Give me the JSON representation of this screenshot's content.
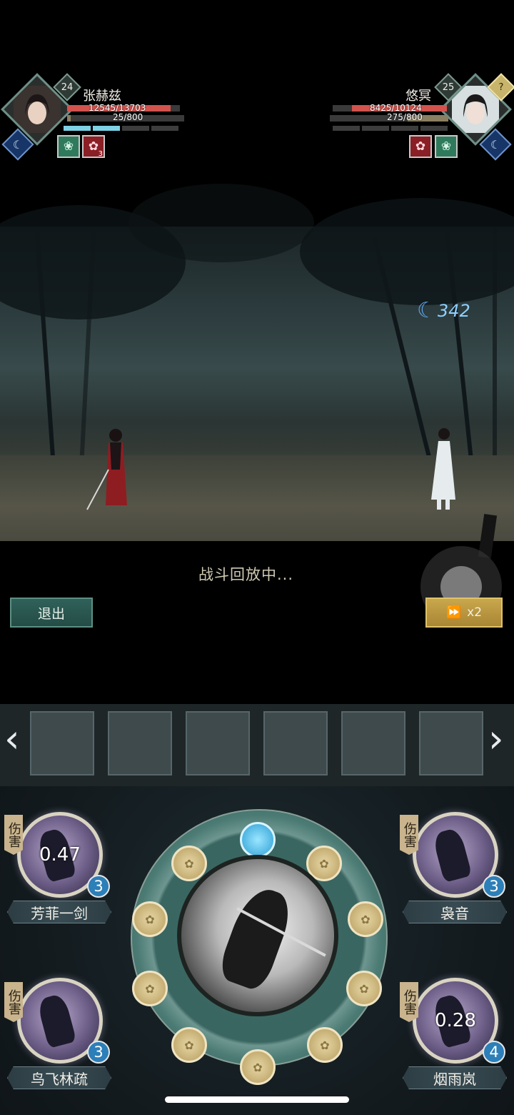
{
  "player": {
    "name": "张赫兹",
    "level": "24",
    "hp": "12545/13703",
    "hp_fraction": 0.915,
    "mp": "25/800",
    "mp_fraction": 0.031,
    "energy_segments_on": 2,
    "buffs": [
      {
        "icon": "lotus-icon",
        "count": ""
      },
      {
        "icon": "blossom-icon",
        "count": "3"
      }
    ]
  },
  "enemy": {
    "name": "悠冥",
    "level": "25",
    "extra_badge": "?",
    "hp": "8425/10124",
    "hp_fraction": 0.832,
    "mp": "275/800",
    "mp_fraction": 0.344,
    "energy_segments_on": 0,
    "buffs": [
      {
        "icon": "blossom-plus-icon",
        "count": ""
      },
      {
        "icon": "lotus-icon",
        "count": ""
      }
    ]
  },
  "scene": {
    "damage_number": "342",
    "replay_text": "战斗回放中..."
  },
  "controls": {
    "exit_label": "退出",
    "speed_label": "x2"
  },
  "skills": [
    {
      "name": "芳菲一剑",
      "tag": "伤害",
      "cooldown": "0.47",
      "count": "3"
    },
    {
      "name": "袅音",
      "tag": "伤害",
      "cooldown": "",
      "count": "3"
    },
    {
      "name": "鸟飞林疏",
      "tag": "伤害",
      "cooldown": "",
      "count": "3"
    },
    {
      "name": "烟雨岚",
      "tag": "伤害",
      "cooldown": "0.28",
      "count": "4"
    }
  ],
  "colors": {
    "hp": "#d2534e",
    "energy": "#7ed2e6",
    "speed_button": "#c9a74d",
    "exit_button": "#2f615a"
  }
}
